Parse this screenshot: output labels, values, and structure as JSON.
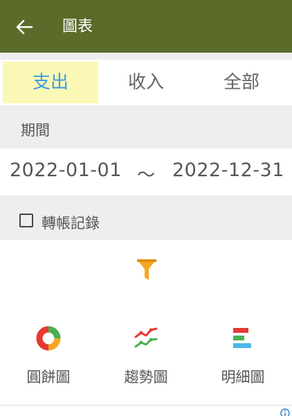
{
  "appbar": {
    "title": "圖表",
    "back_icon": "arrow-left-icon"
  },
  "tabs": [
    {
      "label": "支出",
      "active": true
    },
    {
      "label": "收入",
      "active": false
    },
    {
      "label": "全部",
      "active": false
    }
  ],
  "period": {
    "label": "期間",
    "start": "2022-01-01",
    "separator": "～",
    "end": "2022-12-31"
  },
  "transfer": {
    "label": "轉帳記錄",
    "checked": false
  },
  "filter": {
    "icon": "funnel-icon",
    "color": "#f5a623"
  },
  "charts": [
    {
      "label": "圓餅圖",
      "icon": "pie-chart-icon"
    },
    {
      "label": "趨勢圖",
      "icon": "trend-chart-icon"
    },
    {
      "label": "明細圖",
      "icon": "bar-detail-chart-icon"
    }
  ],
  "colors": {
    "appbar": "#5a6b2a",
    "active_tab_bg": "#fbf8b5",
    "active_tab_text": "#3a9ce0",
    "section_bg": "#eeeeee"
  }
}
